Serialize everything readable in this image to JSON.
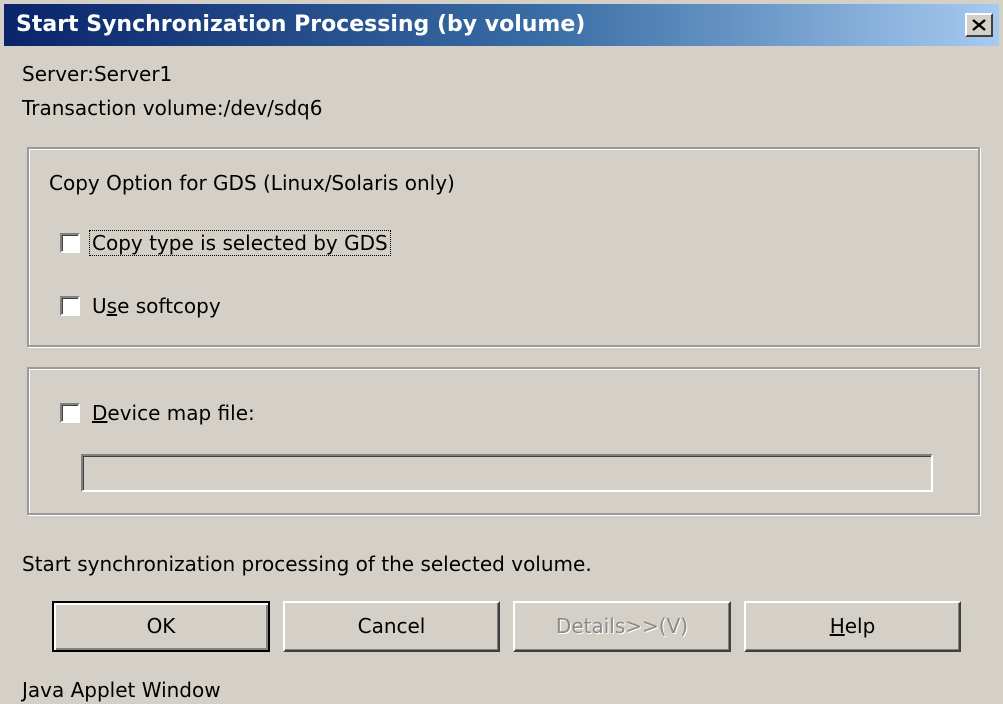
{
  "window": {
    "title": "Start Synchronization Processing (by volume)",
    "close_icon": "close-icon"
  },
  "info": {
    "server": "Server:Server1",
    "transaction_volume": "Transaction volume:/dev/sdq6"
  },
  "copy_option_group": {
    "label": "Copy Option for GDS (Linux/Solaris only)",
    "copy_type_checkbox": {
      "label": "Copy type is selected by GDS",
      "checked": false
    },
    "softcopy_checkbox": {
      "label_pre": "U",
      "label_mnemonic": "s",
      "label_post": "e softcopy",
      "checked": false
    }
  },
  "device_map_group": {
    "checkbox": {
      "label_mnemonic": "D",
      "label_post": "evice map file:",
      "checked": false
    },
    "path_value": ""
  },
  "status_message": "Start synchronization processing of the selected volume.",
  "buttons": {
    "ok": "OK",
    "cancel": "Cancel",
    "details": "Details>>(V)",
    "help_mnemonic": "H",
    "help_post": "elp"
  },
  "footer": "Java Applet Window"
}
